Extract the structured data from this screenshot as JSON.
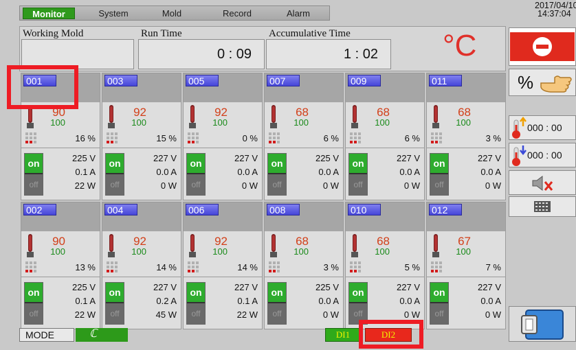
{
  "tabs": [
    {
      "label": "Monitor",
      "active": true
    },
    {
      "label": "System",
      "active": false
    },
    {
      "label": "Mold",
      "active": false
    },
    {
      "label": "Record",
      "active": false
    },
    {
      "label": "Alarm",
      "active": false
    }
  ],
  "datetime": {
    "date": "2017/04/10",
    "time": "14:37:04"
  },
  "header": {
    "working_mold_label": "Working Mold",
    "working_mold_value": "",
    "run_time_label": "Run Time",
    "run_time_value": "0 : 09",
    "accumulative_label": "Accumulative Time",
    "accumulative_value": "1 : 02",
    "unit": "°C"
  },
  "zones": [
    {
      "id": "001",
      "temp": "90",
      "set": "100",
      "pct": "16 %",
      "volt": "225 V",
      "amp": "0.1 A",
      "watt": "22 W",
      "on": "on",
      "off": "off"
    },
    {
      "id": "003",
      "temp": "92",
      "set": "100",
      "pct": "15 %",
      "volt": "227 V",
      "amp": "0.0 A",
      "watt": "0 W",
      "on": "on",
      "off": "off"
    },
    {
      "id": "005",
      "temp": "92",
      "set": "100",
      "pct": "0 %",
      "volt": "227 V",
      "amp": "0.0 A",
      "watt": "0 W",
      "on": "on",
      "off": "off"
    },
    {
      "id": "007",
      "temp": "68",
      "set": "100",
      "pct": "6 %",
      "volt": "225 V",
      "amp": "0.0 A",
      "watt": "0 W",
      "on": "on",
      "off": "off"
    },
    {
      "id": "009",
      "temp": "68",
      "set": "100",
      "pct": "6 %",
      "volt": "227 V",
      "amp": "0.0 A",
      "watt": "0 W",
      "on": "on",
      "off": "off"
    },
    {
      "id": "011",
      "temp": "68",
      "set": "100",
      "pct": "3 %",
      "volt": "227 V",
      "amp": "0.0 A",
      "watt": "0 W",
      "on": "on",
      "off": "off"
    },
    {
      "id": "002",
      "temp": "90",
      "set": "100",
      "pct": "13 %",
      "volt": "225 V",
      "amp": "0.1 A",
      "watt": "22 W",
      "on": "on",
      "off": "off"
    },
    {
      "id": "004",
      "temp": "92",
      "set": "100",
      "pct": "14 %",
      "volt": "227 V",
      "amp": "0.2 A",
      "watt": "45 W",
      "on": "on",
      "off": "off"
    },
    {
      "id": "006",
      "temp": "92",
      "set": "100",
      "pct": "14 %",
      "volt": "227 V",
      "amp": "0.1 A",
      "watt": "22 W",
      "on": "on",
      "off": "off"
    },
    {
      "id": "008",
      "temp": "68",
      "set": "100",
      "pct": "3 %",
      "volt": "225 V",
      "amp": "0.0 A",
      "watt": "0 W",
      "on": "on",
      "off": "off"
    },
    {
      "id": "010",
      "temp": "68",
      "set": "100",
      "pct": "5 %",
      "volt": "227 V",
      "amp": "0.0 A",
      "watt": "0 W",
      "on": "on",
      "off": "off"
    },
    {
      "id": "012",
      "temp": "67",
      "set": "100",
      "pct": "7 %",
      "volt": "227 V",
      "amp": "0.0 A",
      "watt": "0 W",
      "on": "on",
      "off": "off"
    }
  ],
  "right_panel": {
    "stop_icon": "stop-icon",
    "percent_label": "%",
    "temp_up_label": "000 : 00",
    "temp_down_label": "000 : 00",
    "mute_icon": "mute-icon",
    "keypad_icon": "keypad-icon",
    "exit_icon": "exit-icon"
  },
  "footer": {
    "mode_label": "MODE",
    "mode_indicator": "ℂ",
    "di1_label": "DI1",
    "di2_label": "DI2"
  },
  "colors": {
    "tab_active": "#2f9a1c",
    "zone_label": "#4646d8",
    "temp_text": "#d2401a",
    "set_text": "#1a8a1a",
    "unit_text": "#e0302a",
    "highlight": "#ee1c24",
    "di1_bg": "#2faa1a",
    "di2_bg": "#e8281c"
  }
}
